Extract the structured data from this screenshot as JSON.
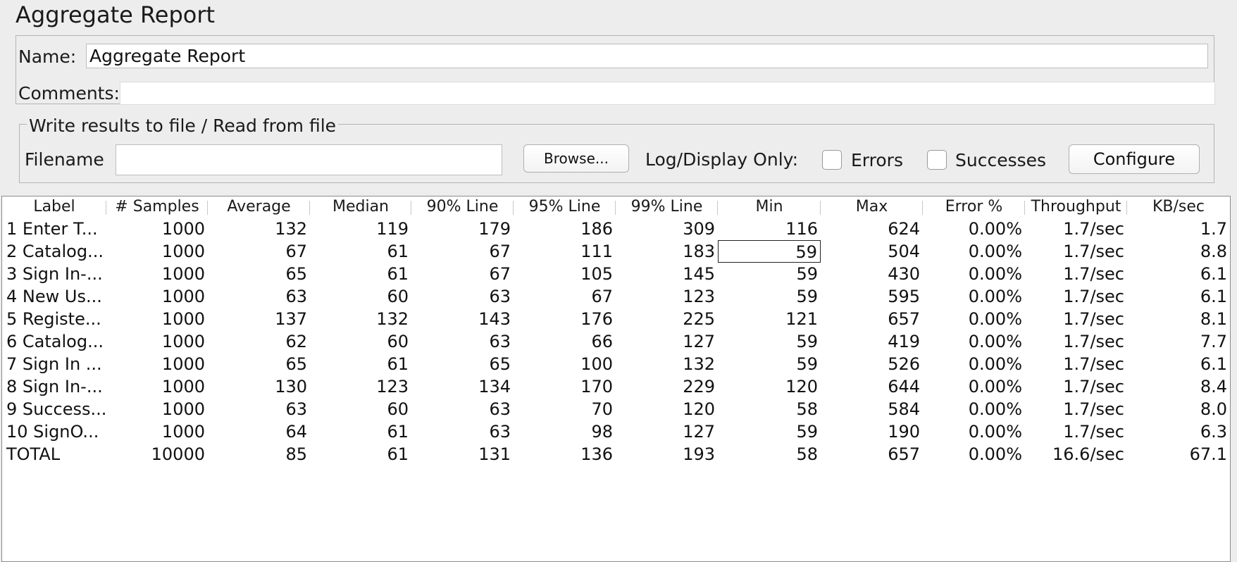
{
  "title": "Aggregate Report",
  "name_field": {
    "label": "Name:",
    "value": "Aggregate Report"
  },
  "comments_field": {
    "label": "Comments:",
    "value": ""
  },
  "file_group": {
    "legend": "Write results to file / Read from file",
    "filename_label": "Filename",
    "filename_value": "",
    "browse_label": "Browse...",
    "log_display_label": "Log/Display Only:",
    "errors_label": "Errors",
    "errors_checked": false,
    "successes_label": "Successes",
    "successes_checked": false,
    "configure_label": "Configure"
  },
  "table": {
    "columns": [
      "Label",
      "# Samples",
      "Average",
      "Median",
      "90% Line",
      "95% Line",
      "99% Line",
      "Min",
      "Max",
      "Error %",
      "Throughput",
      "KB/sec"
    ],
    "rows": [
      [
        "1 Enter T...",
        "1000",
        "132",
        "119",
        "179",
        "186",
        "309",
        "116",
        "624",
        "0.00%",
        "1.7/sec",
        "1.7"
      ],
      [
        "2 Catalog...",
        "1000",
        "67",
        "61",
        "67",
        "111",
        "183",
        "59",
        "504",
        "0.00%",
        "1.7/sec",
        "8.8"
      ],
      [
        "3 Sign In-...",
        "1000",
        "65",
        "61",
        "67",
        "105",
        "145",
        "59",
        "430",
        "0.00%",
        "1.7/sec",
        "6.1"
      ],
      [
        "4 New Us...",
        "1000",
        "63",
        "60",
        "63",
        "67",
        "123",
        "59",
        "595",
        "0.00%",
        "1.7/sec",
        "6.1"
      ],
      [
        "5 Registe...",
        "1000",
        "137",
        "132",
        "143",
        "176",
        "225",
        "121",
        "657",
        "0.00%",
        "1.7/sec",
        "8.1"
      ],
      [
        "6 Catalog...",
        "1000",
        "62",
        "60",
        "63",
        "66",
        "127",
        "59",
        "419",
        "0.00%",
        "1.7/sec",
        "7.7"
      ],
      [
        "7 Sign In ...",
        "1000",
        "65",
        "61",
        "65",
        "100",
        "132",
        "59",
        "526",
        "0.00%",
        "1.7/sec",
        "6.1"
      ],
      [
        "8 Sign In-...",
        "1000",
        "130",
        "123",
        "134",
        "170",
        "229",
        "120",
        "644",
        "0.00%",
        "1.7/sec",
        "8.4"
      ],
      [
        "9 Success...",
        "1000",
        "63",
        "60",
        "63",
        "70",
        "120",
        "58",
        "584",
        "0.00%",
        "1.7/sec",
        "8.0"
      ],
      [
        "10 SignO...",
        "1000",
        "64",
        "61",
        "63",
        "98",
        "127",
        "59",
        "190",
        "0.00%",
        "1.7/sec",
        "6.3"
      ],
      [
        "TOTAL",
        "10000",
        "85",
        "61",
        "131",
        "136",
        "193",
        "58",
        "657",
        "0.00%",
        "16.6/sec",
        "67.1"
      ]
    ],
    "focused_cell": {
      "row": 1,
      "col": 7
    }
  }
}
